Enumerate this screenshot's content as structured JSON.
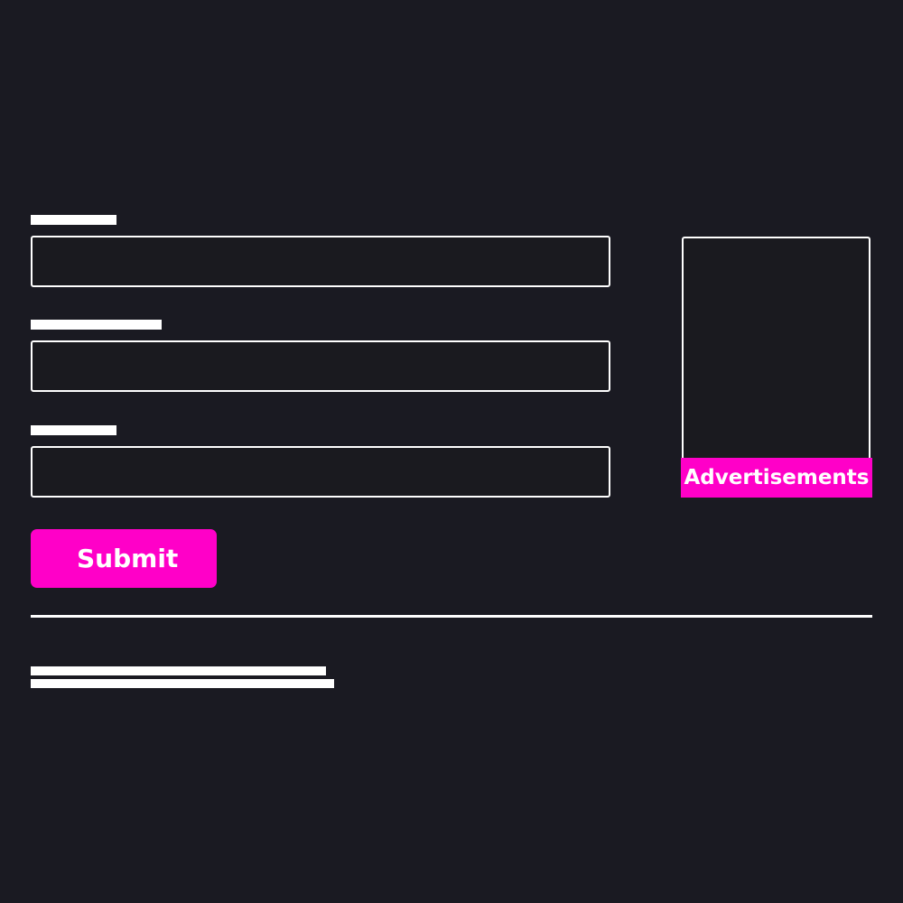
{
  "form": {
    "fields": [
      {
        "value": "",
        "placeholder": ""
      },
      {
        "value": "",
        "placeholder": ""
      },
      {
        "value": "",
        "placeholder": ""
      }
    ],
    "submit_label": "Submit"
  },
  "sidebar": {
    "ad_label": "Advertisements"
  },
  "colors": {
    "background": "#1a1a22",
    "accent": "#ff00c8",
    "foreground": "#ffffff"
  }
}
